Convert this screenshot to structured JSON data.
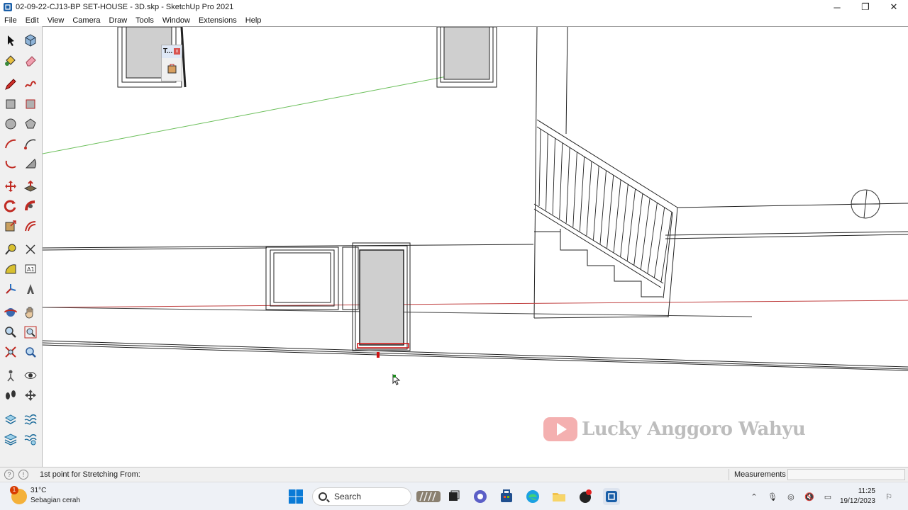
{
  "window": {
    "title": "02-09-22-CJ13-BP SET-HOUSE - 3D.skp - SketchUp Pro 2021",
    "minimize": "─",
    "maximize": "❐",
    "close": "✕"
  },
  "menu": [
    "File",
    "Edit",
    "View",
    "Camera",
    "Draw",
    "Tools",
    "Window",
    "Extensions",
    "Help"
  ],
  "tray_window": {
    "title": "T...",
    "close": "x"
  },
  "watermark": {
    "text": "Lucky Anggoro Wahyu"
  },
  "status": {
    "prompt": "1st point for Stretching From:",
    "measurements_label": "Measurements",
    "measurements_value": ""
  },
  "taskbar": {
    "weather_temp": "31°C",
    "weather_desc": "Sebagian cerah",
    "weather_badge": "1",
    "search_placeholder": "Search",
    "time": "11:25",
    "date": "19/12/2023"
  },
  "colors": {
    "accent": "#0067c0",
    "axis_green": "#6bbf5a",
    "axis_red": "#c04040",
    "selection_red": "#d01010",
    "glass_gray": "#cfcfcf"
  }
}
